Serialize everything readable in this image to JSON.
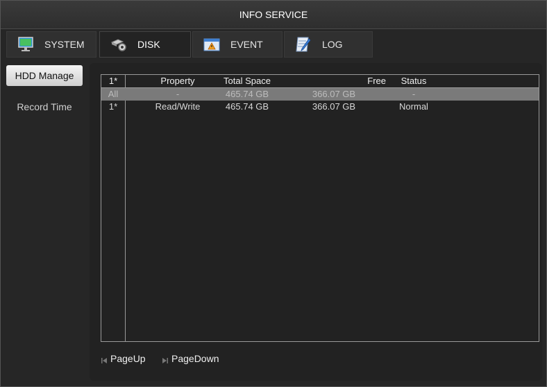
{
  "window": {
    "title": "INFO SERVICE"
  },
  "tabs": [
    {
      "label": "SYSTEM",
      "icon": "monitor-icon"
    },
    {
      "label": "DISK",
      "icon": "disk-gear-icon"
    },
    {
      "label": "EVENT",
      "icon": "warning-window-icon"
    },
    {
      "label": "LOG",
      "icon": "notepad-pen-icon"
    }
  ],
  "sidebar": {
    "items": [
      {
        "label": "HDD Manage"
      },
      {
        "label": "Record Time"
      }
    ]
  },
  "table": {
    "headers": [
      "1*",
      "Property",
      "Total Space",
      "Free",
      "Status"
    ],
    "rows": [
      {
        "id": "All",
        "property": "-",
        "total": "465.74 GB",
        "free": "366.07 GB",
        "status": "-"
      },
      {
        "id": "1*",
        "property": "Read/Write",
        "total": "465.74 GB",
        "free": "366.07 GB",
        "status": "Normal"
      }
    ]
  },
  "pager": {
    "page_up": "PageUp",
    "page_down": "PageDown"
  },
  "colors": {
    "selected_row": "#7a7a7a",
    "active_sidebar": "#e8e8e8",
    "background": "#262626"
  }
}
